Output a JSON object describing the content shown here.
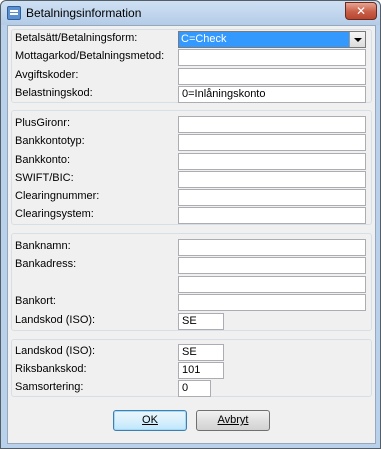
{
  "window": {
    "title": "Betalningsinformation",
    "close_label": "✕"
  },
  "payment": {
    "method_label": "Betalsätt/Betalningsform:",
    "method_value": "C=Check",
    "receiver_label": "Mottagarkod/Betalningsmetod:",
    "receiver_value": "",
    "fee_label": "Avgiftskoder:",
    "fee_value": "",
    "charge_label": "Belastningskod:",
    "charge_value": "0=Inlåningskonto"
  },
  "account": {
    "plusgiro_label": "PlusGironr:",
    "plusgiro_value": "",
    "type_label": "Bankkontotyp:",
    "type_value": "",
    "account_label": "Bankkonto:",
    "account_value": "",
    "swift_label": "SWIFT/BIC:",
    "swift_value": "",
    "clearing_label": "Clearingnummer:",
    "clearing_value": "",
    "system_label": "Clearingsystem:",
    "system_value": ""
  },
  "bank": {
    "name_label": "Banknamn:",
    "name_value": "",
    "address_label": "Bankadress:",
    "address_line1": "",
    "address_line2": "",
    "city_label": "Bankort:",
    "city_value": "",
    "country_label": "Landskod (ISO):",
    "country_value": "SE"
  },
  "reporting": {
    "country_label": "Landskod (ISO):",
    "country_value": "SE",
    "riksbank_label": "Riksbankskod:",
    "riksbank_value": "101",
    "sort_label": "Samsortering:",
    "sort_value": "0"
  },
  "buttons": {
    "ok_label": "OK",
    "cancel_label": "Avbryt"
  }
}
